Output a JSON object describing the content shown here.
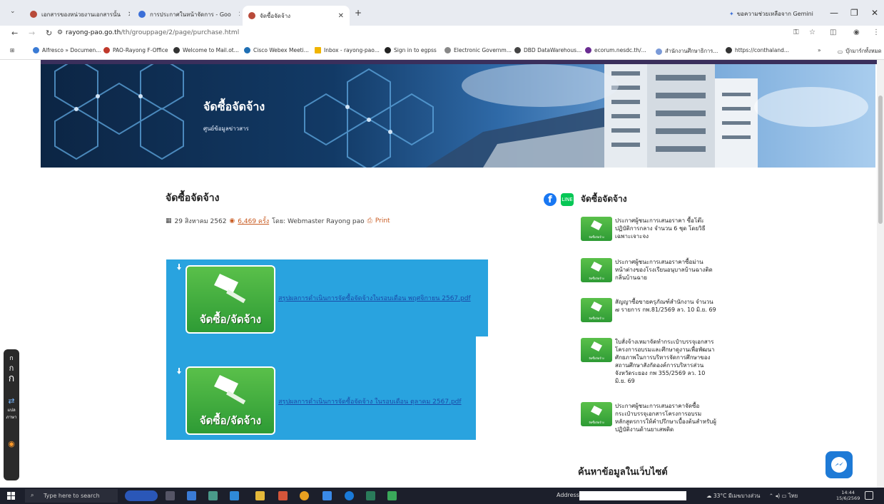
{
  "browser": {
    "tabs": [
      {
        "label": "เอกสารของหน่วยงานเอกสารนั้น",
        "active": false
      },
      {
        "label": "การประกาศในหน้าจัดการ - Goo",
        "active": false
      },
      {
        "label": "จัดซื้อจัดจ้าง",
        "active": true
      }
    ],
    "new_tab": "+",
    "gemini_label": "ขอความช่วยเหลือจาก Gemini",
    "win_minimize": "—",
    "win_restore": "❐",
    "win_close": "✕",
    "url_site": "rayong-pao.go.th",
    "url_path": "/th/grouppage/2/page/purchase.html",
    "bookmarks": [
      {
        "label": "Alfresco » Documen...",
        "color": "#3a7bd5"
      },
      {
        "label": "PAO-Rayong F-Office",
        "color": "#c0392b"
      },
      {
        "label": "Welcome to Mail.ot...",
        "color": "#333333"
      },
      {
        "label": "Cisco Webex Meeti...",
        "color": "#1f6fb4"
      },
      {
        "label": "Inbox - rayong-pao...",
        "color": "#f0b400"
      },
      {
        "label": "Sign in to egpss",
        "color": "#222222"
      },
      {
        "label": "Electronic Governm...",
        "color": "#888888"
      },
      {
        "label": "DBD DataWarehous...",
        "color": "#444444"
      },
      {
        "label": "ecorum.nesdc.th/...",
        "color": "#6a2c91"
      },
      {
        "label": "สำนักงานศึกษาธิการ...",
        "color": "#7a9ad8"
      },
      {
        "label": "https://conthaland...",
        "color": "#333333"
      }
    ],
    "bookmarks_more": "»",
    "bookmarks_folder": "บุ๊กมาร์กทั้งหมด"
  },
  "hero": {
    "title": "จัดซื้อจัดจ้าง",
    "subtitle": "ศูนย์ข้อมูลข่าวสาร"
  },
  "post": {
    "title": "จัดซื้อจัดจ้าง",
    "date": "29 สิงหาคม 2562",
    "views": "6,469 ครั้ง",
    "by": "โดย: Webmaster Rayong pao",
    "print": "Print"
  },
  "files": [
    {
      "thumb_caption": "จัดซื้อ/จัดจ้าง",
      "link": "สรุปผลการดำเนินการจัดซื้อจัดจ้างในรอบเดือน พฤศจิกายน 2567.pdf"
    },
    {
      "thumb_caption": "จัดซื้อ/จัดจ้าง",
      "link": "สรุปผลการดำเนินการจัดซื้อจัดจ้าง ในรอบเดือน ตุลาคม 2567.pdf"
    }
  ],
  "sidebar": {
    "share_facebook": "f",
    "share_line": "LINE",
    "title": "จัดซื้อจัดจ้าง",
    "thumb_caption": "จัดซื้อจัดจ้าง",
    "items": [
      {
        "text": "ประกาศผู้ชนะการเสนอราคา ซื้อโต๊ะปฏิบัติการกลาง จำนวน 6 ชุด โดยวิธีเฉพาะเจาะจง"
      },
      {
        "text": "ประกาศผู้ชนะการเสนอราคาซื้อม่านหน้าต่างของโรงเรียนอนุบาลบ้านฉางติดกลิ่นบ้านฉาย"
      },
      {
        "text": "สัญญาซื้อขายครุภัณฑ์สำนักงาน จำนวน ๗ รายการ กพ.81/2569 ลว. 10 มิ.ย. 69"
      },
      {
        "text": "ใบสั่งจ้างเหมาจัดทำกระเป๋าบรรจุเอกสาร โครงการอบรมและศึกษาดูงานเพื่อพัฒนาศักยภาพในการบริหารจัดการศึกษาของสถานศึกษาสังกัดองค์การบริหารส่วนจังหวัดระยอง กพ 355/2569 ลว. 10 มิ.ย. 69"
      },
      {
        "text": "ประกาศผู้ชนะการเสนอราคาจัดซื้อกระเป๋าบรรจุเอกสารโครงการอบรมหลักสูตรการให้คำปรึกษาเบื้องต้นสำหรับผู้ปฏิบัติงานด้านยาเสพติด"
      }
    ],
    "search_title": "ค้นหาข้อมูลในเว็บไซต์"
  },
  "left_widget": {
    "g1": "ก",
    "g2": "ก",
    "g3": "ก",
    "translate": "แปลภาษา"
  },
  "taskbar": {
    "search_placeholder": "Type here to search",
    "address_label": "Address",
    "weather": "33°C มีเมฆบางส่วน",
    "lang": "ไทย",
    "time": "14:44",
    "date": "15/6/2569"
  }
}
